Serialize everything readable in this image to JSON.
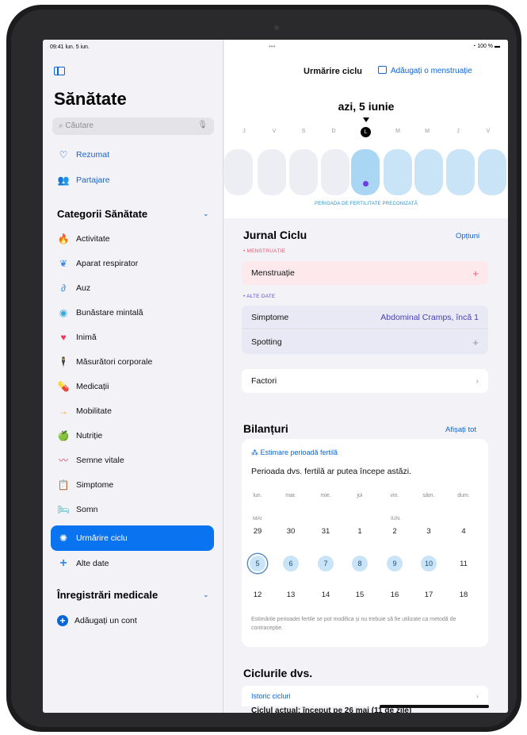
{
  "status": {
    "time_date": "09:41 lun. 5 iun.",
    "battery": "100 %",
    "dots": "•••"
  },
  "sidebar": {
    "title": "Sănătate",
    "search_placeholder": "Căutare",
    "top_items": [
      {
        "label": "Rezumat",
        "icon": "heart-outline-icon"
      },
      {
        "label": "Partajare",
        "icon": "people-icon"
      }
    ],
    "categories_header": "Categorii Sănătate",
    "categories": [
      {
        "label": "Activitate",
        "icon": "flame-icon",
        "color": "#f0622b"
      },
      {
        "label": "Aparat respirator",
        "icon": "lungs-icon",
        "color": "#3b8ae6"
      },
      {
        "label": "Auz",
        "icon": "ear-icon",
        "color": "#3b8ae6"
      },
      {
        "label": "Bunăstare mintală",
        "icon": "brain-icon",
        "color": "#3aa6d9"
      },
      {
        "label": "Inimă",
        "icon": "heart-icon",
        "color": "#ea3a5f"
      },
      {
        "label": "Măsurători corporale",
        "icon": "figure-icon",
        "color": "#9a46d9"
      },
      {
        "label": "Medicații",
        "icon": "pills-icon",
        "color": "#3ab2d9"
      },
      {
        "label": "Mobilitate",
        "icon": "arrow-icon",
        "color": "#f5a623"
      },
      {
        "label": "Nutriție",
        "icon": "apple-icon",
        "color": "#4cb84c"
      },
      {
        "label": "Semne vitale",
        "icon": "waveform-icon",
        "color": "#e0405a"
      },
      {
        "label": "Simptome",
        "icon": "clipboard-icon",
        "color": "#4a7fd9"
      },
      {
        "label": "Somn",
        "icon": "bed-icon",
        "color": "#2fb7c7"
      },
      {
        "label": "Urmărire ciclu",
        "icon": "cycle-icon",
        "color": "#ffffff"
      },
      {
        "label": "Alte date",
        "icon": "plus-icon",
        "color": "#3b8ae6"
      }
    ],
    "records_header": "Înregistrări medicale",
    "add_account": "Adăugați un cont"
  },
  "main": {
    "toolbar_title": "Urmărire ciclu",
    "toolbar_add": "Adăugați o menstruație",
    "today_label": "azi, 5 iunie",
    "day_letters": [
      "J",
      "V",
      "S",
      "D",
      "L",
      "M",
      "M",
      "J",
      "V"
    ],
    "fertile_label": "PERIOADA DE FERTILITATE PRECONIZATĂ",
    "journal_title": "Jurnal Ciclu",
    "journal_options": "Opțiuni",
    "menstruation_header": "• MENSTRUAȚIE",
    "menstruation_row": "Menstruație",
    "other_header": "• ALTE DATE",
    "symptoms_row": "Simptome",
    "symptoms_value": "Abdominal Cramps, încă 1",
    "spotting_row": "Spotting",
    "factors_row": "Factori",
    "plus": "+",
    "chevron": "›"
  },
  "bilanturi": {
    "title": "Bilanțuri",
    "show_all": "Afișați tot",
    "subtitle": "Estimare perioadă fertilă",
    "text": "Perioada dvs. fertilă ar putea începe astăzi.",
    "weekdays": [
      "lun.",
      "mar.",
      "mie.",
      "joi",
      "vin.",
      "sâm.",
      "dum."
    ],
    "month_mai": "MAI",
    "month_iun": "IUN.",
    "week1": [
      "29",
      "30",
      "31",
      "1",
      "2",
      "3",
      "4"
    ],
    "week2": [
      "5",
      "6",
      "7",
      "8",
      "9",
      "10",
      "11"
    ],
    "week3": [
      "12",
      "13",
      "14",
      "15",
      "16",
      "17",
      "18"
    ],
    "note": "Estimările perioadei fertile se pot modifica și nu trebuie să fie utilizate ca metodă de contracepție."
  },
  "cycles": {
    "title": "Ciclurile dvs.",
    "history": "Istoric cicluri",
    "current": "Ciclul actual: început pe 26 mai (11 de zile)"
  }
}
